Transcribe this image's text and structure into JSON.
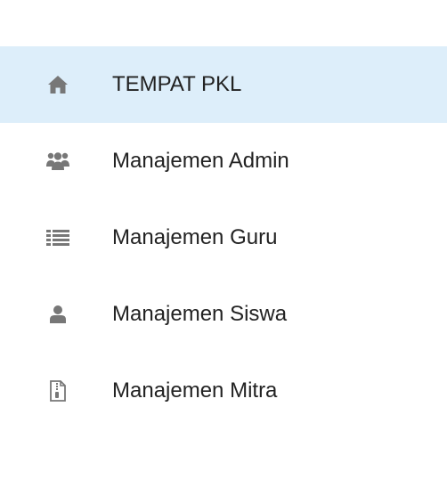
{
  "sidebar": {
    "items": [
      {
        "label": "TEMPAT PKL",
        "icon": "home-icon",
        "active": true
      },
      {
        "label": "Manajemen Admin",
        "icon": "users-icon",
        "active": false
      },
      {
        "label": "Manajemen Guru",
        "icon": "list-icon",
        "active": false
      },
      {
        "label": "Manajemen Siswa",
        "icon": "user-icon",
        "active": false
      },
      {
        "label": "Manajemen Mitra",
        "icon": "file-icon",
        "active": false
      }
    ]
  },
  "colors": {
    "active_background": "#ddeefa",
    "icon": "#777777",
    "text": "#222222"
  }
}
